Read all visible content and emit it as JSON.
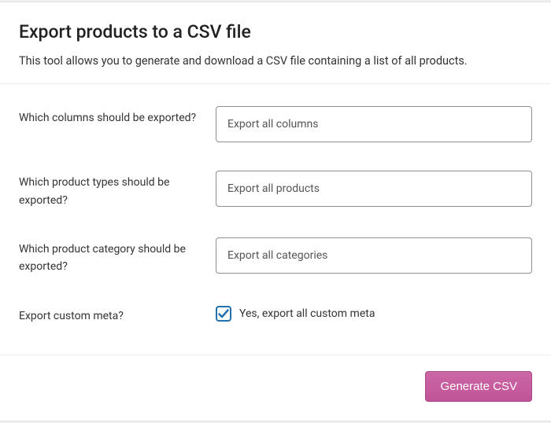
{
  "header": {
    "title": "Export products to a CSV file",
    "description": "This tool allows you to generate and download a CSV file containing a list of all products."
  },
  "form": {
    "columns": {
      "label": "Which columns should be exported?",
      "value": "Export all columns"
    },
    "types": {
      "label": "Which product types should be exported?",
      "value": "Export all products"
    },
    "category": {
      "label": "Which product category should be exported?",
      "value": "Export all categories"
    },
    "meta": {
      "label": "Export custom meta?",
      "checkbox_label": "Yes, export all custom meta",
      "checked": true
    }
  },
  "footer": {
    "submit_label": "Generate CSV"
  }
}
